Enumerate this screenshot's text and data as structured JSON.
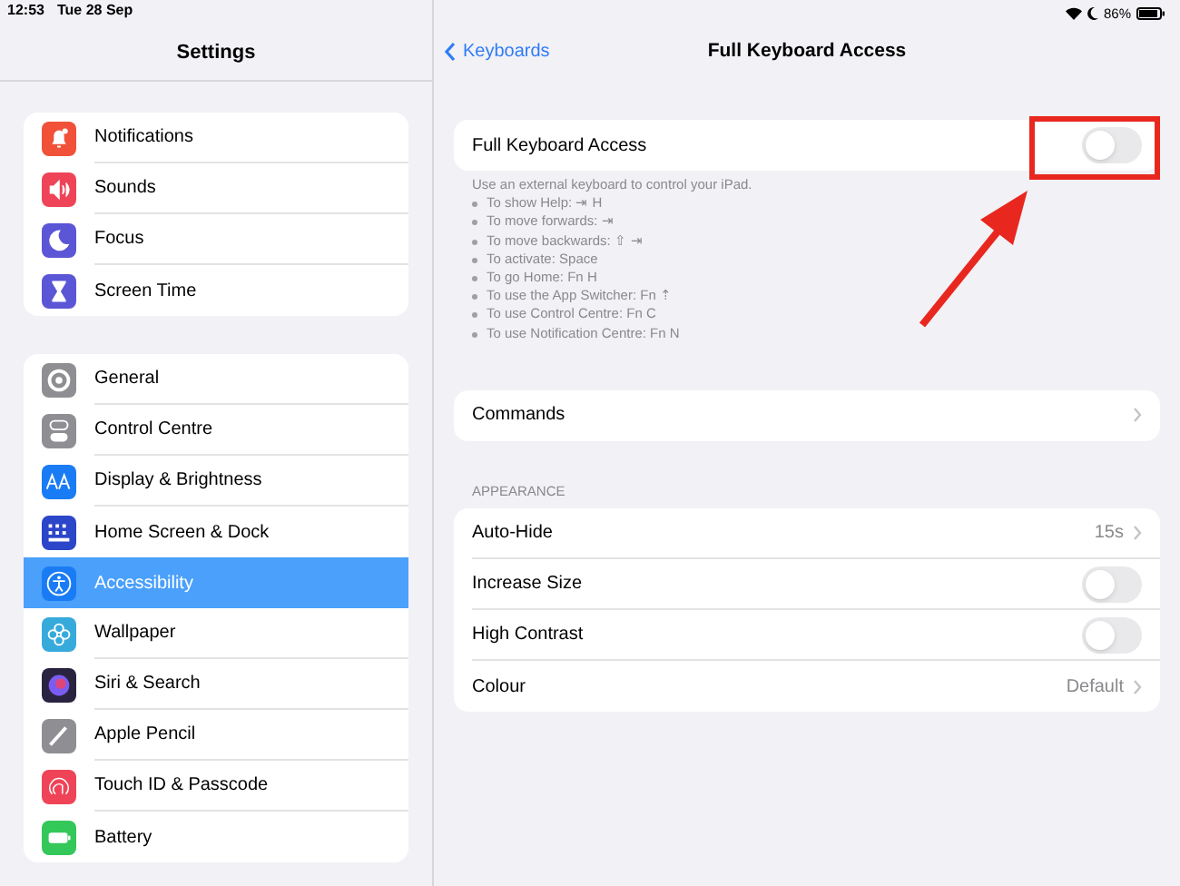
{
  "status_bar": {
    "time": "12:53",
    "date": "Tue 28 Sep",
    "battery": "86%"
  },
  "sidebar": {
    "title": "Settings",
    "groups": [
      [
        {
          "label": "Notifications",
          "color": "#f05138",
          "selected": false
        },
        {
          "label": "Sounds",
          "color": "#ef4458",
          "selected": false
        },
        {
          "label": "Focus",
          "color": "#5b56d6",
          "selected": false
        },
        {
          "label": "Screen Time",
          "color": "#5b56d6",
          "selected": false
        }
      ],
      [
        {
          "label": "General",
          "color": "#8e8e93",
          "selected": false
        },
        {
          "label": "Control Centre",
          "color": "#8e8e93",
          "selected": false
        },
        {
          "label": "Display & Brightness",
          "color": "#1a7cf5",
          "selected": false
        },
        {
          "label": "Home Screen & Dock",
          "color": "#2b46c9",
          "selected": false
        },
        {
          "label": "Accessibility",
          "color": "#1a7cf5",
          "selected": true
        },
        {
          "label": "Wallpaper",
          "color": "#37aadc",
          "selected": false
        },
        {
          "label": "Siri & Search",
          "color": "#2a2340",
          "selected": false
        },
        {
          "label": "Apple Pencil",
          "color": "#8e8e93",
          "selected": false
        },
        {
          "label": "Touch ID & Passcode",
          "color": "#ef4458",
          "selected": false
        },
        {
          "label": "Battery",
          "color": "#34c759",
          "selected": false
        }
      ]
    ]
  },
  "detail": {
    "back": "Keyboards",
    "title": "Full Keyboard Access",
    "main_toggle": {
      "label": "Full Keyboard Access",
      "on": false
    },
    "hint": "Use an external keyboard to control your iPad.",
    "shortcuts": [
      "To show Help: ⇥ H",
      "To move forwards: ⇥",
      "To move backwards: ⇧ ⇥",
      "To activate: Space",
      "To go Home: Fn H",
      "To use the App Switcher: Fn ⇡",
      "To use Control Centre: Fn C",
      "To use Notification Centre: Fn N"
    ],
    "commands": {
      "label": "Commands"
    },
    "section_header": "APPEARANCE",
    "rows": [
      {
        "kind": "link",
        "label": "Auto-Hide",
        "value": "15s"
      },
      {
        "kind": "toggle",
        "label": "Increase Size",
        "on": false
      },
      {
        "kind": "toggle",
        "label": "High Contrast",
        "on": false
      },
      {
        "kind": "link",
        "label": "Colour",
        "value": "Default"
      }
    ]
  }
}
